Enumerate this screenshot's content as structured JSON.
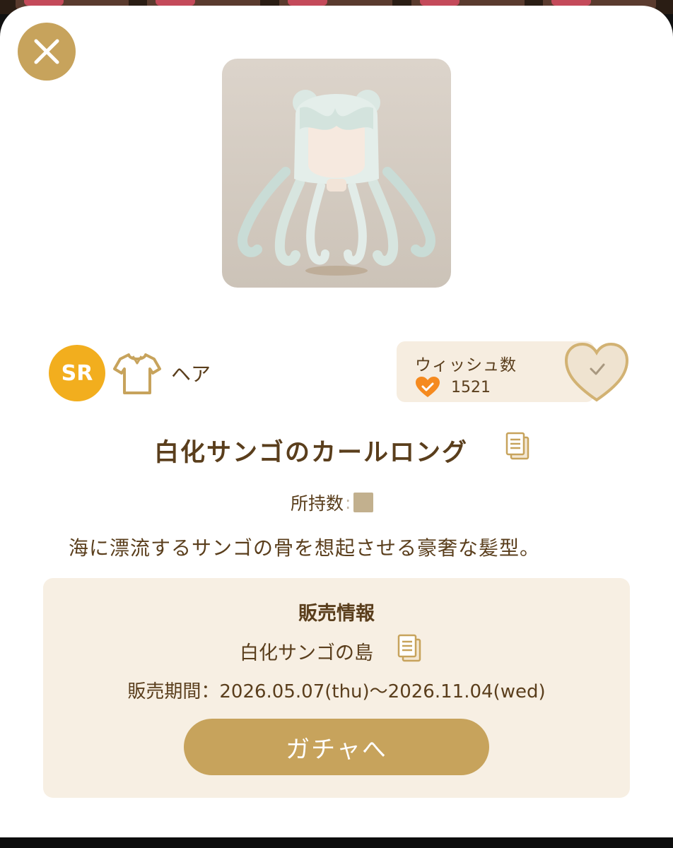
{
  "item": {
    "rarity": "SR",
    "category": "ヘア",
    "name": "白化サンゴのカールロング",
    "owned_label": "所持数",
    "owned_separator": ":",
    "description": "海に漂流するサンゴの骨を想起させる豪奢な髪型。"
  },
  "wish": {
    "title": "ウィッシュ数",
    "count": "1521"
  },
  "sale": {
    "title": "販売情報",
    "location": "白化サンゴの島",
    "period": "販売期間：2026.05.07(thu)〜2026.11.04(wed)",
    "button_label": "ガチャへ"
  },
  "colors": {
    "accent_gold": "#c7a35c",
    "rarity_orange": "#f2ae1e",
    "text_brown": "#5a3e1c",
    "panel_cream": "#f7efe3",
    "heart_orange": "#f58a1f"
  },
  "icons": {
    "close": "close-icon",
    "category": "shirt-icon",
    "wish_small": "heart-icon",
    "wish_button": "heart-check-icon",
    "copy": "document-icon"
  }
}
